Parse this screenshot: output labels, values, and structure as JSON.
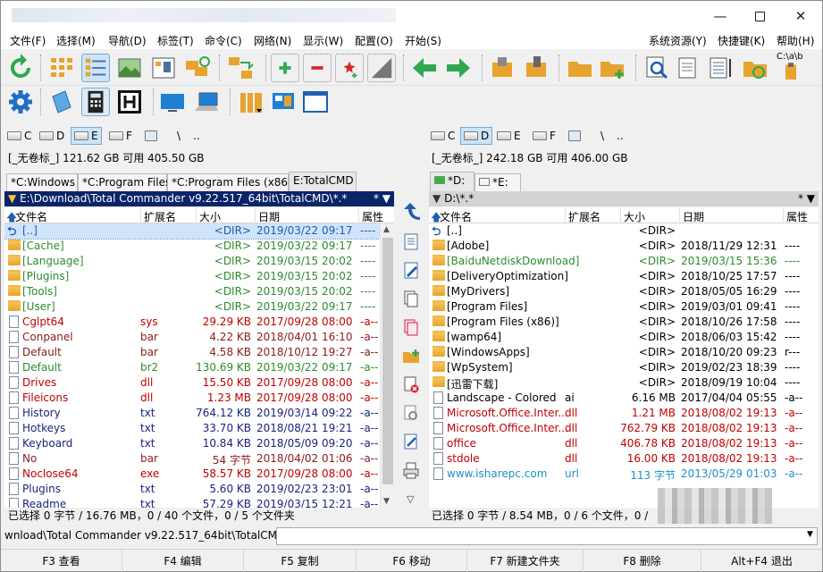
{
  "menu": [
    "文件(F)",
    "选择(M)",
    "导航(D)",
    "标签(T)",
    "命令(C)",
    "网络(N)",
    "显示(W)",
    "配置(O)",
    "开始(S)",
    "系统资源(Y)",
    "快捷键(K)",
    "帮助(H)"
  ],
  "toolbar": {
    "copy_names_label": "C:\\a\\b"
  },
  "left": {
    "drives": [
      "C",
      "D",
      "E",
      "F",
      "\\",
      ".."
    ],
    "selected_drive": "E",
    "info": "[_无卷标_]  121.62 GB 可用 405.50 GB",
    "tabs": [
      "*C:Windows",
      "*C:Program Files",
      "*C:Program Files (x86)",
      "E:TotalCMD"
    ],
    "active_tab": 3,
    "path": "E:\\Download\\Total Commander v9.22.517_64bit\\TotalCMD\\*.*",
    "path_buttons": "* ▼",
    "columns": [
      "文件名",
      "扩展名",
      "大小",
      "日期",
      "属性"
    ],
    "rows": [
      {
        "name": "[..]",
        "ext": "",
        "size": "<DIR>",
        "date": "2019/03/22 09:17",
        "attr": "----",
        "type": "up",
        "color": "#1f5fae"
      },
      {
        "name": "[Cache]",
        "ext": "",
        "size": "<DIR>",
        "date": "2019/03/22 09:17",
        "attr": "----",
        "type": "folder",
        "color": "#2e8b2e"
      },
      {
        "name": "[Language]",
        "ext": "",
        "size": "<DIR>",
        "date": "2019/03/15 20:02",
        "attr": "----",
        "type": "folder",
        "color": "#2e8b2e"
      },
      {
        "name": "[Plugins]",
        "ext": "",
        "size": "<DIR>",
        "date": "2019/03/15 20:02",
        "attr": "----",
        "type": "folder",
        "color": "#2e8b2e"
      },
      {
        "name": "[Tools]",
        "ext": "",
        "size": "<DIR>",
        "date": "2019/03/15 20:02",
        "attr": "----",
        "type": "folder",
        "color": "#2e8b2e"
      },
      {
        "name": "[User]",
        "ext": "",
        "size": "<DIR>",
        "date": "2019/03/22 09:17",
        "attr": "----",
        "type": "folder",
        "color": "#2e8b2e"
      },
      {
        "name": "Cglpt64",
        "ext": "sys",
        "size": "29.29 KB",
        "date": "2017/09/28 08:00",
        "attr": "-a--",
        "type": "doc",
        "color": "#c00000"
      },
      {
        "name": "Conpanel",
        "ext": "bar",
        "size": "4.22 KB",
        "date": "2018/04/01 16:10",
        "attr": "-a--",
        "type": "doc",
        "color": "#8b1a1a"
      },
      {
        "name": "Default",
        "ext": "bar",
        "size": "4.58 KB",
        "date": "2018/10/12 19:27",
        "attr": "-a--",
        "type": "doc",
        "color": "#8b1a1a"
      },
      {
        "name": "Default",
        "ext": "br2",
        "size": "130.69 KB",
        "date": "2019/03/22 09:17",
        "attr": "-a--",
        "type": "doc",
        "color": "#2e8b2e"
      },
      {
        "name": "Drives",
        "ext": "dll",
        "size": "15.50 KB",
        "date": "2017/09/28 08:00",
        "attr": "-a--",
        "type": "doc",
        "color": "#c00000"
      },
      {
        "name": "Fileicons",
        "ext": "dll",
        "size": "1.23 MB",
        "date": "2017/09/28 08:00",
        "attr": "-a--",
        "type": "doc",
        "color": "#c00000"
      },
      {
        "name": "History",
        "ext": "txt",
        "size": "764.12 KB",
        "date": "2019/03/14 09:22",
        "attr": "-a--",
        "type": "doc",
        "color": "#1a237e"
      },
      {
        "name": "Hotkeys",
        "ext": "txt",
        "size": "33.70 KB",
        "date": "2018/08/21 19:21",
        "attr": "-a--",
        "type": "doc",
        "color": "#1a237e"
      },
      {
        "name": "Keyboard",
        "ext": "txt",
        "size": "10.84 KB",
        "date": "2018/05/09 09:20",
        "attr": "-a--",
        "type": "doc",
        "color": "#1a237e"
      },
      {
        "name": "No",
        "ext": "bar",
        "size": "54 字节",
        "date": "2018/04/02 01:06",
        "attr": "-a--",
        "type": "doc",
        "color": "#8b1a1a"
      },
      {
        "name": "Noclose64",
        "ext": "exe",
        "size": "58.57 KB",
        "date": "2017/09/28 08:00",
        "attr": "-a--",
        "type": "doc",
        "color": "#c00000"
      },
      {
        "name": "Plugins",
        "ext": "txt",
        "size": "5.60 KB",
        "date": "2019/02/23 23:01",
        "attr": "-a--",
        "type": "doc",
        "color": "#1a237e"
      },
      {
        "name": "Readme",
        "ext": "txt",
        "size": "57.29 KB",
        "date": "2019/03/15 12:21",
        "attr": "-a--",
        "type": "doc",
        "color": "#1a237e"
      }
    ],
    "status": "已选择 0 字节 / 16.76 MB，0 / 40 个文件，0 / 5 个文件夹"
  },
  "right": {
    "drives": [
      "C",
      "D",
      "E",
      "F",
      "\\",
      ".."
    ],
    "selected_drive": "D",
    "info": "[_无卷标_]  242.18 GB 可用 406.00 GB",
    "tabs": [
      "*D:",
      "*E:"
    ],
    "active_tab": 0,
    "path": "D:\\*.*",
    "path_buttons": "* ▼",
    "columns": [
      "文件名",
      "扩展名",
      "大小",
      "日期",
      "属性"
    ],
    "rows": [
      {
        "name": "[..]",
        "ext": "",
        "size": "<DIR>",
        "date": "",
        "attr": "",
        "type": "up",
        "color": "#000000"
      },
      {
        "name": "[Adobe]",
        "ext": "",
        "size": "<DIR>",
        "date": "2018/11/29 12:31",
        "attr": "----",
        "type": "folder",
        "color": "#000000"
      },
      {
        "name": "[BaiduNetdiskDownload]",
        "ext": "",
        "size": "<DIR>",
        "date": "2019/03/15 15:36",
        "attr": "----",
        "type": "folder",
        "color": "#2e8b2e"
      },
      {
        "name": "[DeliveryOptimization]",
        "ext": "",
        "size": "<DIR>",
        "date": "2018/10/25 17:57",
        "attr": "----",
        "type": "folder",
        "color": "#000000"
      },
      {
        "name": "[MyDrivers]",
        "ext": "",
        "size": "<DIR>",
        "date": "2018/05/05 16:29",
        "attr": "----",
        "type": "folder",
        "color": "#000000"
      },
      {
        "name": "[Program Files]",
        "ext": "",
        "size": "<DIR>",
        "date": "2019/03/01 09:41",
        "attr": "----",
        "type": "folder",
        "color": "#000000"
      },
      {
        "name": "[Program Files (x86)]",
        "ext": "",
        "size": "<DIR>",
        "date": "2018/10/26 17:58",
        "attr": "----",
        "type": "folder",
        "color": "#000000"
      },
      {
        "name": "[wamp64]",
        "ext": "",
        "size": "<DIR>",
        "date": "2018/06/03 15:42",
        "attr": "----",
        "type": "folder",
        "color": "#000000"
      },
      {
        "name": "[WindowsApps]",
        "ext": "",
        "size": "<DIR>",
        "date": "2018/10/20 09:23",
        "attr": "r---",
        "type": "folder",
        "color": "#000000"
      },
      {
        "name": "[WpSystem]",
        "ext": "",
        "size": "<DIR>",
        "date": "2019/02/23 18:39",
        "attr": "----",
        "type": "folder",
        "color": "#000000"
      },
      {
        "name": "[迅雷下载]",
        "ext": "",
        "size": "<DIR>",
        "date": "2018/09/19 10:04",
        "attr": "----",
        "type": "folder",
        "color": "#000000"
      },
      {
        "name": "Landscape - Colored",
        "ext": "ai",
        "size": "6.16 MB",
        "date": "2017/04/04 05:55",
        "attr": "-a--",
        "type": "doc",
        "color": "#000000"
      },
      {
        "name": "Microsoft.Office.Inter...",
        "ext": "dll",
        "size": "1.21 MB",
        "date": "2018/08/02 19:13",
        "attr": "-a--",
        "type": "doc",
        "color": "#c00000"
      },
      {
        "name": "Microsoft.Office.Inter...",
        "ext": "dll",
        "size": "762.79 KB",
        "date": "2018/08/02 19:13",
        "attr": "-a--",
        "type": "doc",
        "color": "#c00000"
      },
      {
        "name": "office",
        "ext": "dll",
        "size": "406.78 KB",
        "date": "2018/08/02 19:13",
        "attr": "-a--",
        "type": "doc",
        "color": "#c00000"
      },
      {
        "name": "stdole",
        "ext": "dll",
        "size": "16.00 KB",
        "date": "2018/08/02 19:13",
        "attr": "-a--",
        "type": "doc",
        "color": "#c00000"
      },
      {
        "name": "www.isharepc.com",
        "ext": "url",
        "size": "113 字节",
        "date": "2013/05/29 01:03",
        "attr": "-a--",
        "type": "doc",
        "color": "#1e90c8"
      }
    ],
    "status": "已选择 0 字节 / 8.54 MB，0 / 6 个文件，0 /"
  },
  "cmdline": {
    "prompt": "wnload\\Total Commander v9.22.517_64bit\\TotalCMD>",
    "value": ""
  },
  "fkeys": [
    "F3 查看",
    "F4 编辑",
    "F5 复制",
    "F6 移动",
    "F7 新建文件夹",
    "F8 删除",
    "Alt+F4 退出"
  ]
}
